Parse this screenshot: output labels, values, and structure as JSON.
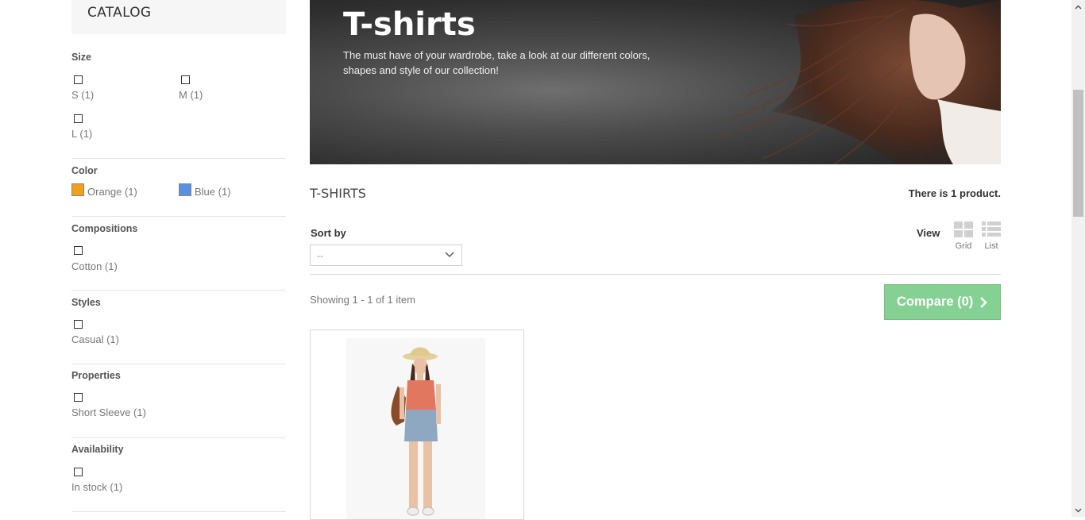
{
  "sidebar": {
    "catalog_title": "CATALOG",
    "facets": {
      "size": {
        "title": "Size",
        "options": [
          "S (1)",
          "M (1)",
          "L (1)"
        ]
      },
      "color": {
        "title": "Color",
        "options": [
          {
            "label": "Orange (1)",
            "color": "#f0a01a"
          },
          {
            "label": "Blue (1)",
            "color": "#5b8fe3"
          }
        ]
      },
      "compositions": {
        "title": "Compositions",
        "options": [
          "Cotton (1)"
        ]
      },
      "styles": {
        "title": "Styles",
        "options": [
          "Casual (1)"
        ]
      },
      "properties": {
        "title": "Properties",
        "options": [
          "Short Sleeve (1)"
        ]
      },
      "availability": {
        "title": "Availability",
        "options": [
          "In stock (1)"
        ]
      }
    }
  },
  "hero": {
    "title": "T-shirts",
    "description": "The must have of your wardrobe, take a look at our different colors, shapes and style of our collection!"
  },
  "listing": {
    "category_name": "T-SHIRTS",
    "product_count": {
      "prefix": "There is ",
      "count": "1",
      "suffix": " product."
    },
    "sort_label": "Sort by",
    "sort_value": "--",
    "view_label": "View",
    "view_grid": "Grid",
    "view_list": "List",
    "showing": "Showing 1 - 1 of 1 item",
    "compare_button": "Compare (0)"
  },
  "colors": {
    "compare_green": "#7fcf8e",
    "accent_dark": "#333333"
  }
}
